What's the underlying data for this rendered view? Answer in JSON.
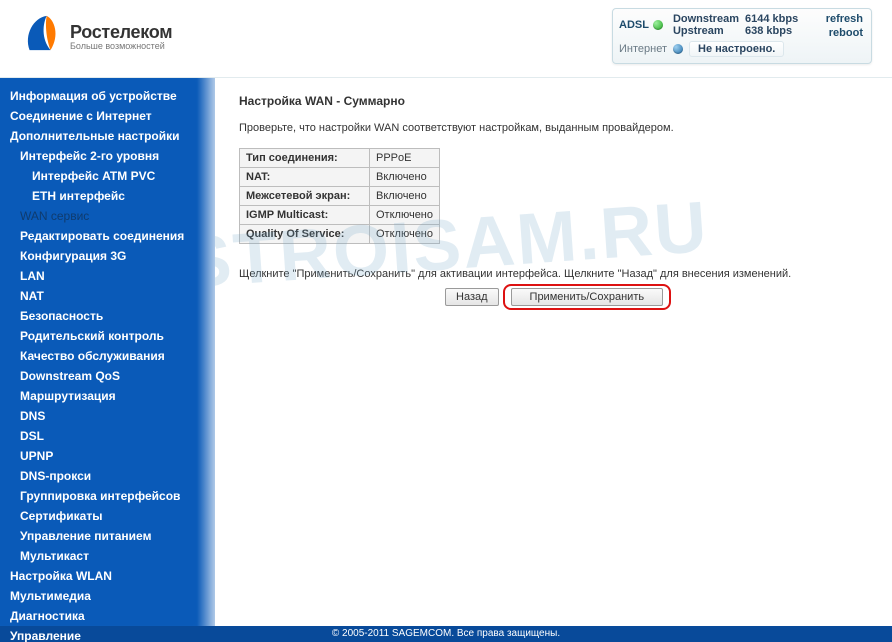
{
  "brand": {
    "name": "Ростелеком",
    "tagline": "Больше возможностей"
  },
  "status": {
    "adsl_label": "ADSL",
    "downstream_label": "Downstream",
    "downstream_value": "6144 kbps",
    "upstream_label": "Upstream",
    "upstream_value": "638 kbps",
    "refresh": "refresh",
    "reboot": "reboot",
    "internet_label": "Интернет",
    "internet_value": "Не настроено."
  },
  "nav": {
    "item0": "Информация об устройстве",
    "item1": "Соединение с Интернет",
    "item2": "Дополнительные настройки",
    "item2_0": "Интерфейс 2-го уровня",
    "item2_0_0": "Интерфейс ATM PVC",
    "item2_0_1": "ETH интерфейс",
    "item2_1": "WAN сервис",
    "item2_2": "Редактировать соединения",
    "item2_3": "Конфигурация 3G",
    "item2_4": "LAN",
    "item2_5": "NAT",
    "item2_6": "Безопасность",
    "item2_7": "Родительский контроль",
    "item2_8": "Качество обслуживания",
    "item2_9": "Downstream QoS",
    "item2_10": "Маршрутизация",
    "item2_11": "DNS",
    "item2_12": "DSL",
    "item2_13": "UPNP",
    "item2_14": "DNS-прокси",
    "item2_15": "Группировка интерфейсов",
    "item2_16": "Сертификаты",
    "item2_17": "Управление питанием",
    "item2_18": "Мультикаст",
    "item3": "Настройка WLAN",
    "item4": "Мультимедиа",
    "item5": "Диагностика",
    "item6": "Управление"
  },
  "main": {
    "title": "Настройка WAN - Суммарно",
    "description": "Проверьте, что настройки WAN соответствуют настройкам, выданным провайдером.",
    "rows": {
      "r0k": "Тип соединения:",
      "r0v": "PPPoE",
      "r1k": "NAT:",
      "r1v": "Включено",
      "r2k": "Межсетевой экран:",
      "r2v": "Включено",
      "r3k": "IGMP Multicast:",
      "r3v": "Отключено",
      "r4k": "Quality Of Service:",
      "r4v": "Отключено"
    },
    "action_text": "Щелкните \"Применить/Сохранить\" для активации интерфейса. Щелкните \"Назад\" для внесения изменений.",
    "back": "Назад",
    "apply": "Применить/Сохранить"
  },
  "watermark": "NASTROISAM.RU",
  "footer": "© 2005-2011 SAGEMCOM. Все права защищены."
}
